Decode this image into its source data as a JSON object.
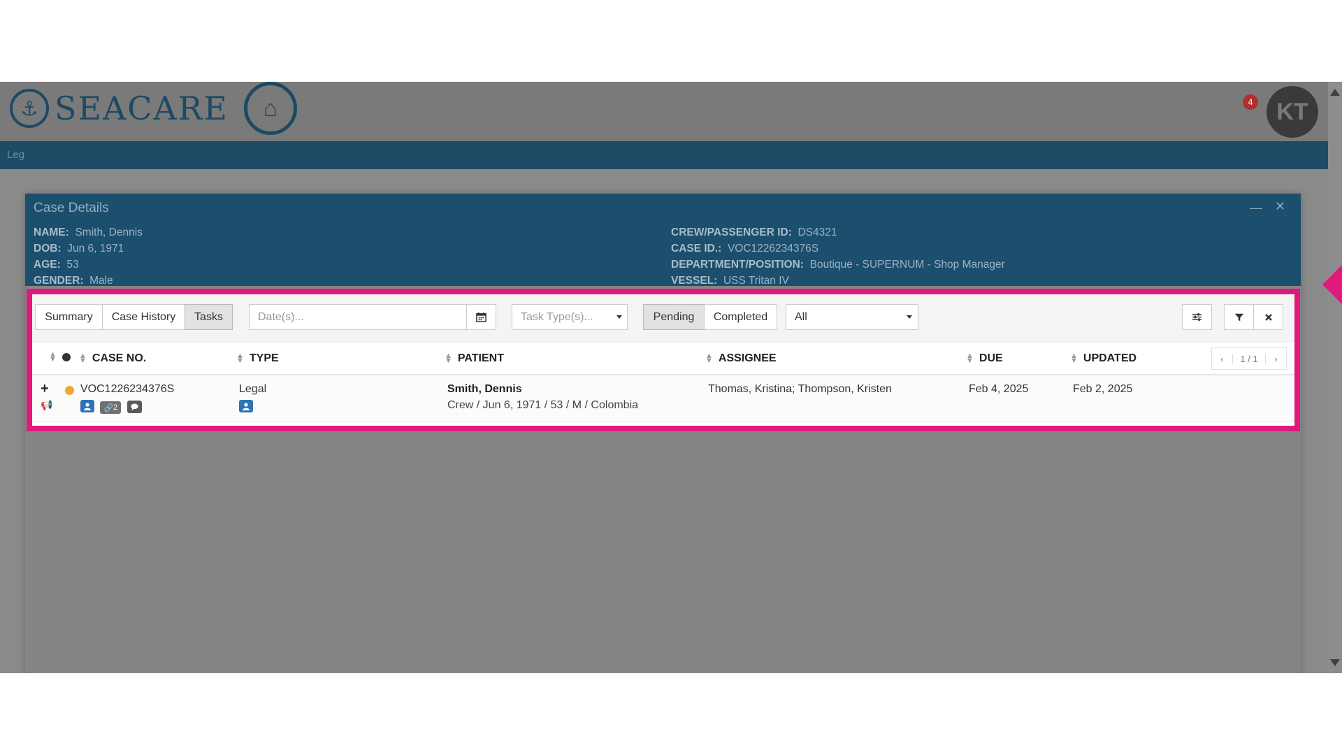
{
  "app": {
    "logo_text": "SEACARE",
    "notification_count": "4",
    "user_initials": "KT",
    "nav_item": "Leg"
  },
  "modal": {
    "title": "Case Details",
    "min_icon": "—",
    "close_icon": "✕",
    "info_left": [
      {
        "label": "NAME:",
        "value": "Smith, Dennis"
      },
      {
        "label": "DOB:",
        "value": "Jun 6, 1971"
      },
      {
        "label": "AGE:",
        "value": "53"
      },
      {
        "label": "GENDER:",
        "value": "Male"
      }
    ],
    "info_right": [
      {
        "label": "CREW/PASSENGER ID:",
        "value": "DS4321"
      },
      {
        "label": "CASE ID.:",
        "value": "VOC1226234376S"
      },
      {
        "label": "DEPARTMENT/POSITION:",
        "value": "Boutique - SUPERNUM - Shop Manager"
      },
      {
        "label": "VESSEL:",
        "value": "USS Tritan IV"
      }
    ]
  },
  "toolbar": {
    "tabs": [
      "Summary",
      "Case History",
      "Tasks"
    ],
    "active_tab": "Tasks",
    "dates_placeholder": "Date(s)...",
    "task_type_placeholder": "Task Type(s)...",
    "status_toggle": [
      "Pending",
      "Completed"
    ],
    "active_status": "Pending",
    "filter_select": "All"
  },
  "table": {
    "columns": [
      "CASE NO.",
      "TYPE",
      "PATIENT",
      "ASSIGNEE",
      "DUE",
      "UPDATED"
    ],
    "pager": {
      "prev": "‹",
      "page": "1 / 1",
      "next": "›"
    },
    "rows": [
      {
        "case_no": "VOC1226234376S",
        "attachment_count": "2",
        "type": "Legal",
        "patient_name": "Smith, Dennis",
        "patient_details": "Crew / Jun 6, 1971 / 53 / M / Colombia",
        "assignee": "Thomas, Kristina; Thompson, Kristen",
        "due": "Feb 4, 2025",
        "updated": "Feb 2, 2025"
      }
    ]
  },
  "colors": {
    "highlight": "#e0197d",
    "header_blue": "#1c4e6e",
    "status_pending": "#f0a637",
    "tag_blue": "#2f73b6"
  }
}
